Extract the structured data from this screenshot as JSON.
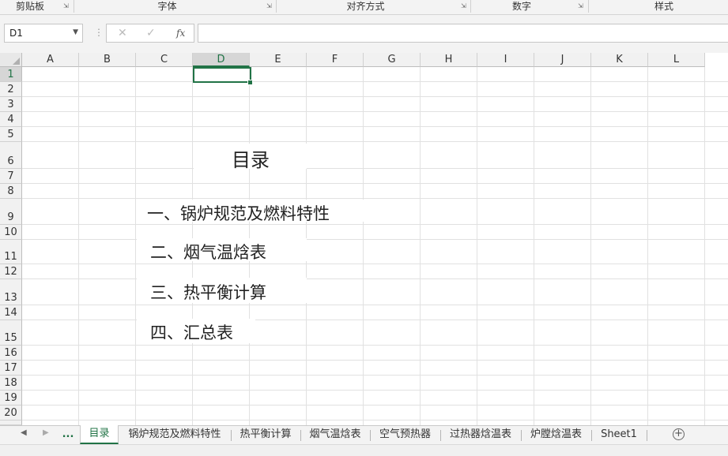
{
  "ribbon": {
    "groups": [
      "剪贴板",
      "字体",
      "对齐方式",
      "数字",
      "样式"
    ]
  },
  "formula_bar": {
    "name_box": "D1",
    "cancel_symbol": "✕",
    "enter_symbol": "✓",
    "fx_label": "fx",
    "formula": ""
  },
  "grid": {
    "columns": [
      "A",
      "B",
      "C",
      "D",
      "E",
      "F",
      "G",
      "H",
      "I",
      "J",
      "K",
      "L"
    ],
    "rows": [
      "1",
      "2",
      "3",
      "4",
      "5",
      "6",
      "7",
      "8",
      "9",
      "10",
      "11",
      "12",
      "13",
      "14",
      "15",
      "16",
      "17",
      "18",
      "19",
      "20"
    ],
    "selected_column": "D",
    "selected_row": "1",
    "cells": {
      "title": "目录",
      "item1": "一、锅炉规范及燃料特性",
      "item2": "二、烟气温焓表",
      "item3": "三、热平衡计算",
      "item4": "四、汇总表"
    }
  },
  "tabs": {
    "ellipsis": "...",
    "items": [
      "目录",
      "锅炉规范及燃料特性",
      "热平衡计算",
      "烟气温焓表",
      "空气预热器",
      "过热器焓温表",
      "炉膛焓温表",
      "Sheet1"
    ],
    "active": "目录",
    "add_symbol": "+"
  },
  "colors": {
    "accent": "#217346",
    "grid_line": "#e1e1e1",
    "header_bg": "#f1f1f1"
  }
}
